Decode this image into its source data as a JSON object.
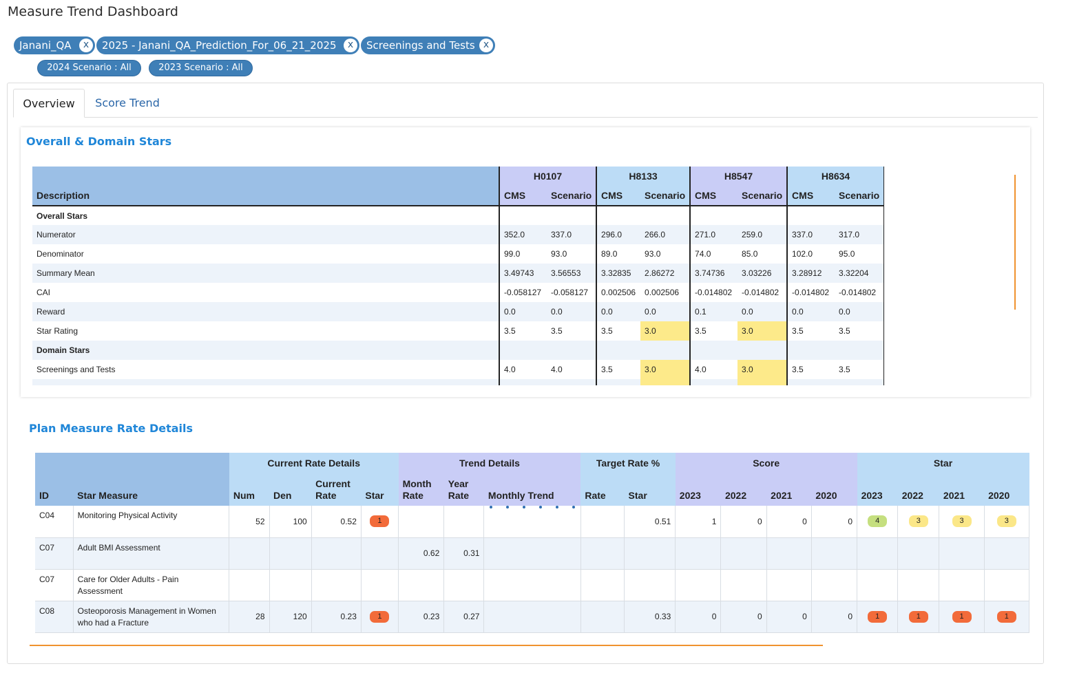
{
  "page": {
    "title": "Measure Trend Dashboard"
  },
  "filters": {
    "chips": [
      {
        "label": "Janani_QA",
        "close": "x"
      },
      {
        "label": "2025 - Janani_QA_Prediction_For_06_21_2025",
        "close": "x"
      },
      {
        "label": "Screenings and Tests",
        "close": "x"
      }
    ],
    "scenarios": [
      {
        "label": "2024 Scenario  :  All"
      },
      {
        "label": "2023 Scenario  :  All"
      }
    ]
  },
  "tabs": [
    {
      "label": "Overview",
      "active": true
    },
    {
      "label": "Score Trend",
      "active": false
    }
  ],
  "overall": {
    "title": "Overall & Domain Stars",
    "description_header": "Description",
    "sub_headers": {
      "cms": "CMS",
      "scenario": "Scenario"
    },
    "plans": [
      "H0107",
      "H8133",
      "H8547",
      "H8634"
    ],
    "rows": [
      {
        "type": "section",
        "label": "Overall Stars",
        "values": [
          "",
          "",
          "",
          "",
          "",
          "",
          "",
          ""
        ]
      },
      {
        "type": "data",
        "label": "Numerator",
        "values": [
          "352.0",
          "337.0",
          "296.0",
          "266.0",
          "271.0",
          "259.0",
          "337.0",
          "317.0"
        ]
      },
      {
        "type": "data",
        "label": "Denominator",
        "values": [
          "99.0",
          "93.0",
          "89.0",
          "93.0",
          "74.0",
          "85.0",
          "102.0",
          "95.0"
        ]
      },
      {
        "type": "data",
        "label": "Summary Mean",
        "values": [
          "3.49743",
          "3.56553",
          "3.32835",
          "2.86272",
          "3.74736",
          "3.03226",
          "3.28912",
          "3.32204"
        ]
      },
      {
        "type": "data",
        "label": "CAI",
        "values": [
          "-0.058127",
          "-0.058127",
          "0.002506",
          "0.002506",
          "-0.014802",
          "-0.014802",
          "-0.014802",
          "-0.014802"
        ]
      },
      {
        "type": "data",
        "label": "Reward",
        "values": [
          "0.0",
          "0.0",
          "0.0",
          "0.0",
          "0.1",
          "0.0",
          "0.0",
          "0.0"
        ]
      },
      {
        "type": "data",
        "label": "Star Rating",
        "values": [
          "3.5",
          "3.5",
          "3.5",
          "3.0",
          "3.5",
          "3.0",
          "3.5",
          "3.5"
        ],
        "highlight": [
          3,
          5
        ]
      },
      {
        "type": "section",
        "label": "Domain Stars",
        "values": [
          "",
          "",
          "",
          "",
          "",
          "",
          "",
          ""
        ]
      },
      {
        "type": "data",
        "label": "Screenings and Tests",
        "values": [
          "4.0",
          "4.0",
          "3.5",
          "3.0",
          "4.0",
          "3.0",
          "3.5",
          "3.5"
        ],
        "highlight": [
          3,
          5
        ]
      },
      {
        "type": "data",
        "label": "",
        "values": [
          "",
          "",
          "",
          "",
          "",
          "",
          "",
          ""
        ],
        "highlight": [
          3,
          5
        ]
      }
    ],
    "highlight_color": "#fdea8a"
  },
  "rates": {
    "title": "Plan Measure Rate Details",
    "groups": [
      "Current Rate Details",
      "Trend Details",
      "Target Rate %",
      "Score",
      "Star"
    ],
    "columns": [
      "ID",
      "Star Measure",
      "Num",
      "Den",
      "Current Rate",
      "Star",
      "Month Rate",
      "Year Rate",
      "Monthly Trend",
      "Rate",
      "Star",
      "2023",
      "2022",
      "2021",
      "2020",
      "2023",
      "2022",
      "2021",
      "2020"
    ],
    "rows": [
      {
        "id": "C04",
        "measure": "Monitoring Physical Activity",
        "num": "52",
        "den": "100",
        "current_rate": "0.52",
        "star": "1",
        "month_rate": "",
        "year_rate": "",
        "trend": true,
        "target_rate": "",
        "target_star": "0.51",
        "score": [
          "1",
          "0",
          "0",
          "0"
        ],
        "stars": [
          "4",
          "3",
          "3",
          "3"
        ],
        "star_colors": [
          "green",
          "yellow",
          "yellow",
          "yellow"
        ]
      },
      {
        "id": "C07",
        "measure": "Adult BMI Assessment",
        "num": "",
        "den": "",
        "current_rate": "",
        "star": "",
        "month_rate": "0.62",
        "year_rate": "0.31",
        "trend": false,
        "target_rate": "",
        "target_star": "",
        "score": [
          "",
          "",
          "",
          ""
        ],
        "stars": [
          "",
          "",
          "",
          ""
        ],
        "star_colors": [
          "",
          "",
          "",
          ""
        ]
      },
      {
        "id": "C07",
        "measure": "Care for Older Adults - Pain Assessment",
        "num": "",
        "den": "",
        "current_rate": "",
        "star": "",
        "month_rate": "",
        "year_rate": "",
        "trend": false,
        "target_rate": "",
        "target_star": "",
        "score": [
          "",
          "",
          "",
          ""
        ],
        "stars": [
          "",
          "",
          "",
          ""
        ],
        "star_colors": [
          "",
          "",
          "",
          ""
        ]
      },
      {
        "id": "C08",
        "measure": "Osteoporosis Management in Women who had a Fracture",
        "num": "28",
        "den": "120",
        "current_rate": "0.23",
        "star": "1",
        "month_rate": "0.23",
        "year_rate": "0.27",
        "trend": false,
        "target_rate": "",
        "target_star": "0.33",
        "score": [
          "0",
          "0",
          "0",
          "0"
        ],
        "stars": [
          "1",
          "1",
          "1",
          "1"
        ],
        "star_colors": [
          "red",
          "red",
          "red",
          "red"
        ]
      }
    ]
  },
  "colors": {
    "chip": "#3f7fb7",
    "accent_title": "#1f86d8",
    "header_blue": "#9bbfe6",
    "header_lavender": "#c9cdf6",
    "header_sky": "#bcdcf6",
    "orange_rule": "#f0922e",
    "badge_red": "#f26b3a",
    "badge_green": "#c5df7f",
    "badge_yellow": "#fbe788"
  }
}
